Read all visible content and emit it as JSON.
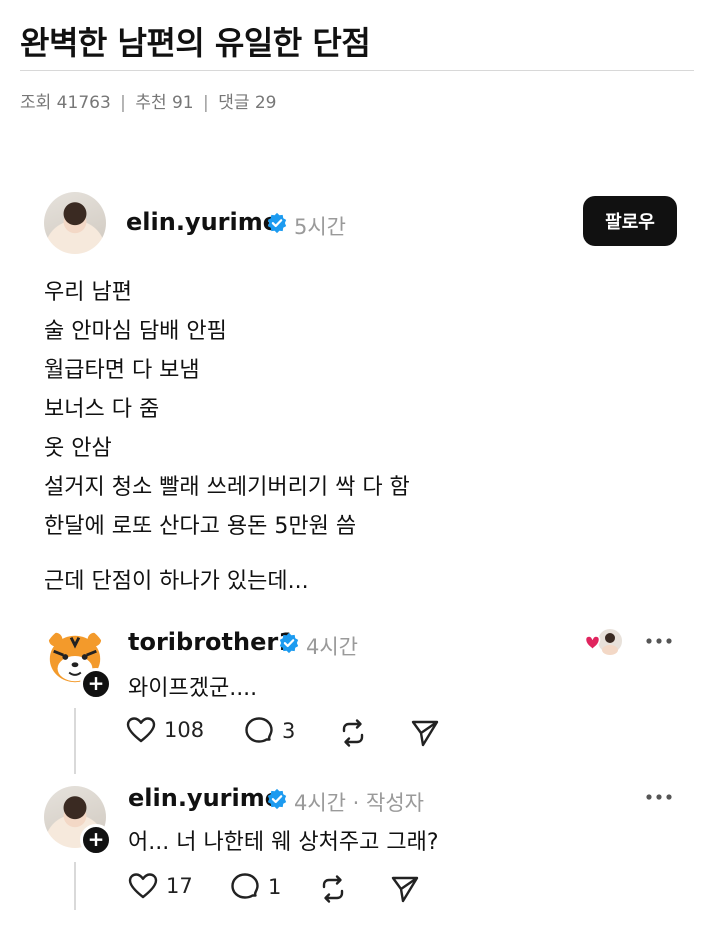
{
  "post": {
    "title": "완벽한 남편의 유일한 단점",
    "meta": {
      "views": "조회 41763",
      "recommends": "추천 91",
      "comments": "댓글 29",
      "separator": "|"
    }
  },
  "thread": {
    "main_post": {
      "username": "elin.yurime",
      "time": "5시간",
      "follow_label": "팔로우",
      "lines": [
        "우리 남편",
        "술 안마심 담배 안핌",
        "월급타면 다 보냄",
        "보너스 다 줌",
        "옷 안삼",
        "설거지 청소 빨래 쓰레기버리기 싹 다 함",
        "한달에 로또 산다고 용돈 5만원 씀",
        "근데 단점이 하나가 있는데..."
      ]
    },
    "replies": [
      {
        "username": "toribrother1",
        "time": "4시간",
        "text": "와이프겠군....",
        "likes": "108",
        "comments": "3"
      },
      {
        "username": "elin.yurime",
        "time": "4시간 · 작성자",
        "text": "어... 너 나한테 웨 상처주고 그래?",
        "likes": "17",
        "comments": "1"
      }
    ]
  },
  "icons": {
    "verified": "verified-badge-icon",
    "like": "heart-icon",
    "comment": "comment-bubble-icon",
    "repost": "repost-icon",
    "share": "send-icon",
    "more": "more-dots-icon",
    "follow": "plus-icon"
  },
  "colors": {
    "verified_blue": "#1d9bf0",
    "button_black": "#111111",
    "muted_text": "#9a9a9a",
    "heart_red": "#e0245e"
  }
}
